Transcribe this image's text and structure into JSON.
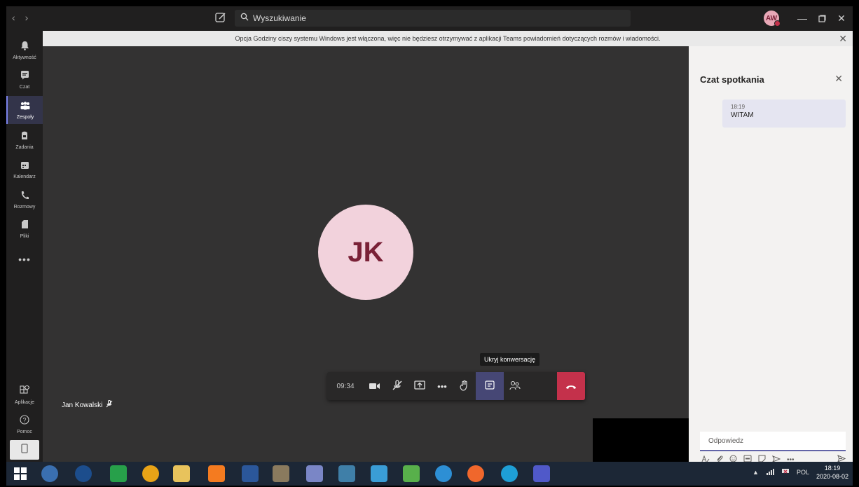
{
  "titlebar": {
    "search_placeholder": "Wyszukiwanie",
    "avatar_initials": "AW"
  },
  "rail": {
    "items": [
      {
        "label": "Aktywność",
        "icon": "bell-icon"
      },
      {
        "label": "Czat",
        "icon": "chat-icon"
      },
      {
        "label": "Zespoły",
        "icon": "teams-icon",
        "active": true
      },
      {
        "label": "Zadania",
        "icon": "tasks-icon"
      },
      {
        "label": "Kalendarz",
        "icon": "calendar-icon"
      },
      {
        "label": "Rozmowy",
        "icon": "phone-icon"
      },
      {
        "label": "Pliki",
        "icon": "files-icon"
      }
    ],
    "more": "•••",
    "bottom": [
      {
        "label": "Aplikacje",
        "icon": "apps-icon"
      },
      {
        "label": "Pomoc",
        "icon": "help-icon"
      }
    ]
  },
  "banner": {
    "text": "Opcja Godziny ciszy systemu Windows jest włączona, więc nie będziesz otrzymywać z aplikacji Teams powiadomień dotyczących rozmów i wiadomości."
  },
  "stage": {
    "participant_initials": "JK",
    "participant_name": "Jan Kowalski",
    "tooltip": "Ukryj konwersację",
    "timer": "09:34"
  },
  "chat": {
    "title": "Czat spotkania",
    "messages": [
      {
        "time": "18:19",
        "text": "WITAM"
      }
    ],
    "reply_placeholder": "Odpowiedz"
  },
  "taskbar": {
    "language": "POL",
    "time": "18:19",
    "date": "2020-08-02"
  },
  "colors": {
    "accent": "#6264a7",
    "hangup": "#c4314b",
    "avatar_bg": "#f2d2dc",
    "avatar_fg": "#7a2137"
  }
}
